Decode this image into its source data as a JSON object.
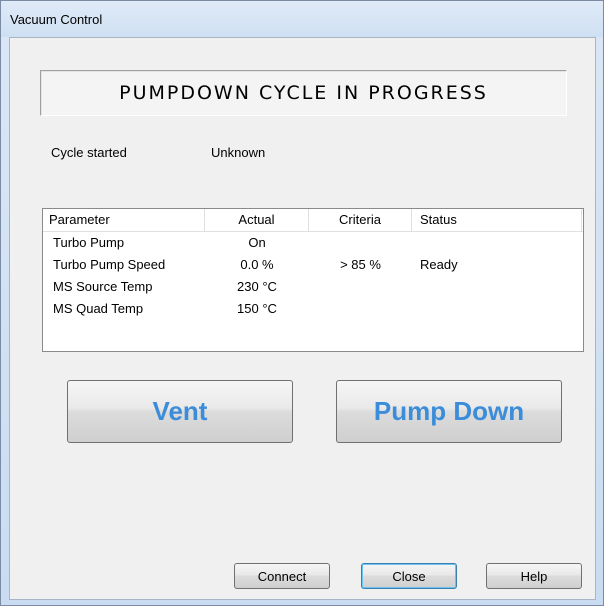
{
  "window": {
    "title": "Vacuum Control"
  },
  "banner": {
    "text": "PUMPDOWN CYCLE IN PROGRESS"
  },
  "cycle": {
    "label": "Cycle started",
    "value": "Unknown"
  },
  "table": {
    "headers": [
      "Parameter",
      "Actual",
      "Criteria",
      "Status"
    ],
    "rows": [
      {
        "parameter": "Turbo Pump",
        "actual": "On",
        "criteria": "",
        "status": ""
      },
      {
        "parameter": "Turbo Pump Speed",
        "actual": "0.0 %",
        "criteria": "> 85 %",
        "status": "Ready"
      },
      {
        "parameter": "MS Source Temp",
        "actual": "230 °C",
        "criteria": "",
        "status": ""
      },
      {
        "parameter": "MS Quad Temp",
        "actual": "150 °C",
        "criteria": "",
        "status": ""
      }
    ]
  },
  "actions": {
    "vent_label": "Vent",
    "pumpdown_label": "Pump Down"
  },
  "buttons": {
    "connect_label": "Connect",
    "close_label": "Close",
    "help_label": "Help"
  },
  "colors": {
    "accent_text": "#3b8cd9"
  }
}
